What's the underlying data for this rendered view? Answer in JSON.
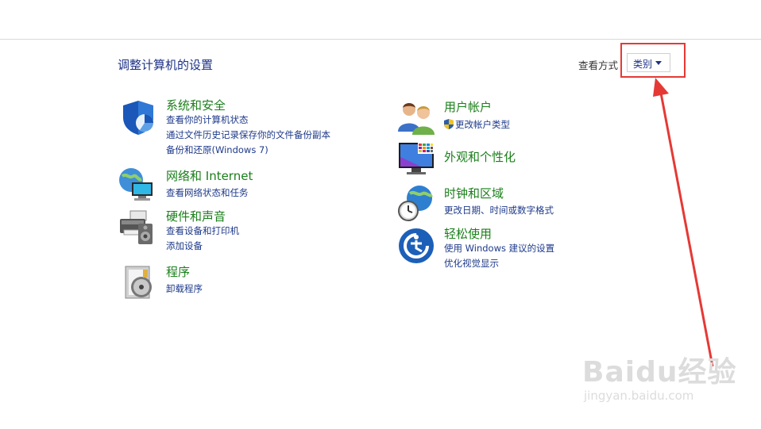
{
  "header": {
    "title": "调整计算机的设置",
    "view_by_label": "查看方式",
    "view_by_value": "类别"
  },
  "categories_left": [
    {
      "title": "系统和安全",
      "icon": "shield-icon",
      "links": [
        "查看你的计算机状态",
        "通过文件历史记录保存你的文件备份副本",
        "备份和还原(Windows 7)"
      ]
    },
    {
      "title": "网络和 Internet",
      "icon": "network-globe-icon",
      "links": [
        "查看网络状态和任务"
      ]
    },
    {
      "title": "硬件和声音",
      "icon": "printer-speaker-icon",
      "links": [
        "查看设备和打印机",
        "添加设备"
      ]
    },
    {
      "title": "程序",
      "icon": "program-disc-icon",
      "links": [
        "卸载程序"
      ]
    }
  ],
  "categories_right": [
    {
      "title": "用户帐户",
      "icon": "users-icon",
      "links": [
        "更改帐户类型"
      ]
    },
    {
      "title": "外观和个性化",
      "icon": "display-icon",
      "links": []
    },
    {
      "title": "时钟和区域",
      "icon": "clock-globe-icon",
      "links": [
        "更改日期、时间或数字格式"
      ]
    },
    {
      "title": "轻松使用",
      "icon": "ease-of-access-icon",
      "links": [
        "使用 Windows 建议的设置",
        "优化视觉显示"
      ]
    }
  ],
  "watermark": {
    "main": "Baidu经验",
    "sub": "jingyan.baidu.com"
  },
  "colors": {
    "title_green": "#1a7f1a",
    "link_blue": "#1e3a8a",
    "highlight_red": "#e53935"
  }
}
